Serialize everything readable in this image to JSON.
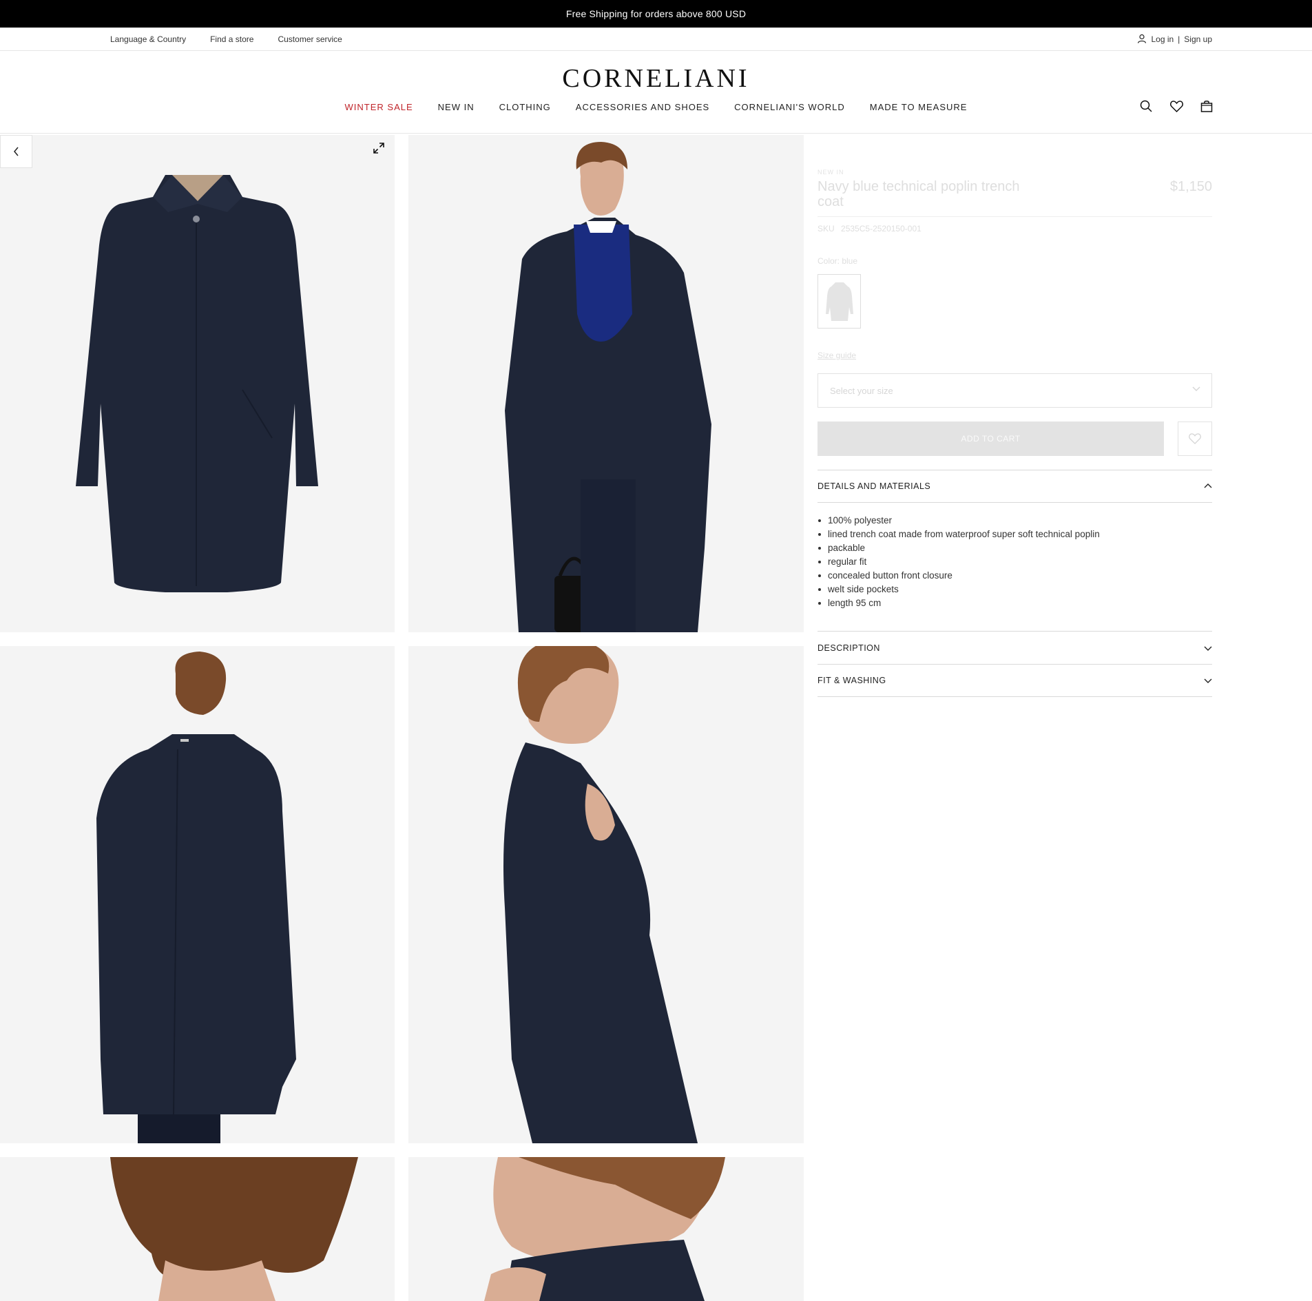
{
  "promo": {
    "text": "Free Shipping for orders above 800 USD"
  },
  "utility": {
    "language": "Language & Country",
    "find_store": "Find a store",
    "customer_service": "Customer service",
    "login": "Log in",
    "separator": "|",
    "signup": "Sign up"
  },
  "brand": {
    "logo": "CORNELIANI"
  },
  "nav": {
    "items": [
      {
        "label": "WINTER SALE"
      },
      {
        "label": "NEW IN"
      },
      {
        "label": "CLOTHING"
      },
      {
        "label": "ACCESSORIES AND SHOES"
      },
      {
        "label": "CORNELIANI'S WORLD"
      },
      {
        "label": "MADE TO MEASURE"
      }
    ],
    "sale_color": "#c0242a"
  },
  "header_icons": [
    "search-icon",
    "heart-icon",
    "bag-icon"
  ],
  "product": {
    "badge": "NEW IN",
    "title": "Navy blue technical poplin trench coat",
    "price": "$1,150",
    "sku_label": "SKU",
    "sku_value": "2535C5-2520150-001",
    "color_label": "Color: blue",
    "size_guide": "Size guide",
    "size_placeholder": "Select your size",
    "add_to_cart": "ADD TO CART",
    "coat_color": "#1f2638"
  },
  "accordions": {
    "details": {
      "title": "DETAILS AND MATERIALS",
      "items": [
        "100% polyester",
        "lined trench coat made from waterproof super soft technical poplin",
        "packable",
        "regular fit",
        "concealed button front closure",
        "welt side pockets",
        "length 95 cm"
      ]
    },
    "description": {
      "title": "DESCRIPTION"
    },
    "fit": {
      "title": "FIT & WASHING"
    }
  }
}
